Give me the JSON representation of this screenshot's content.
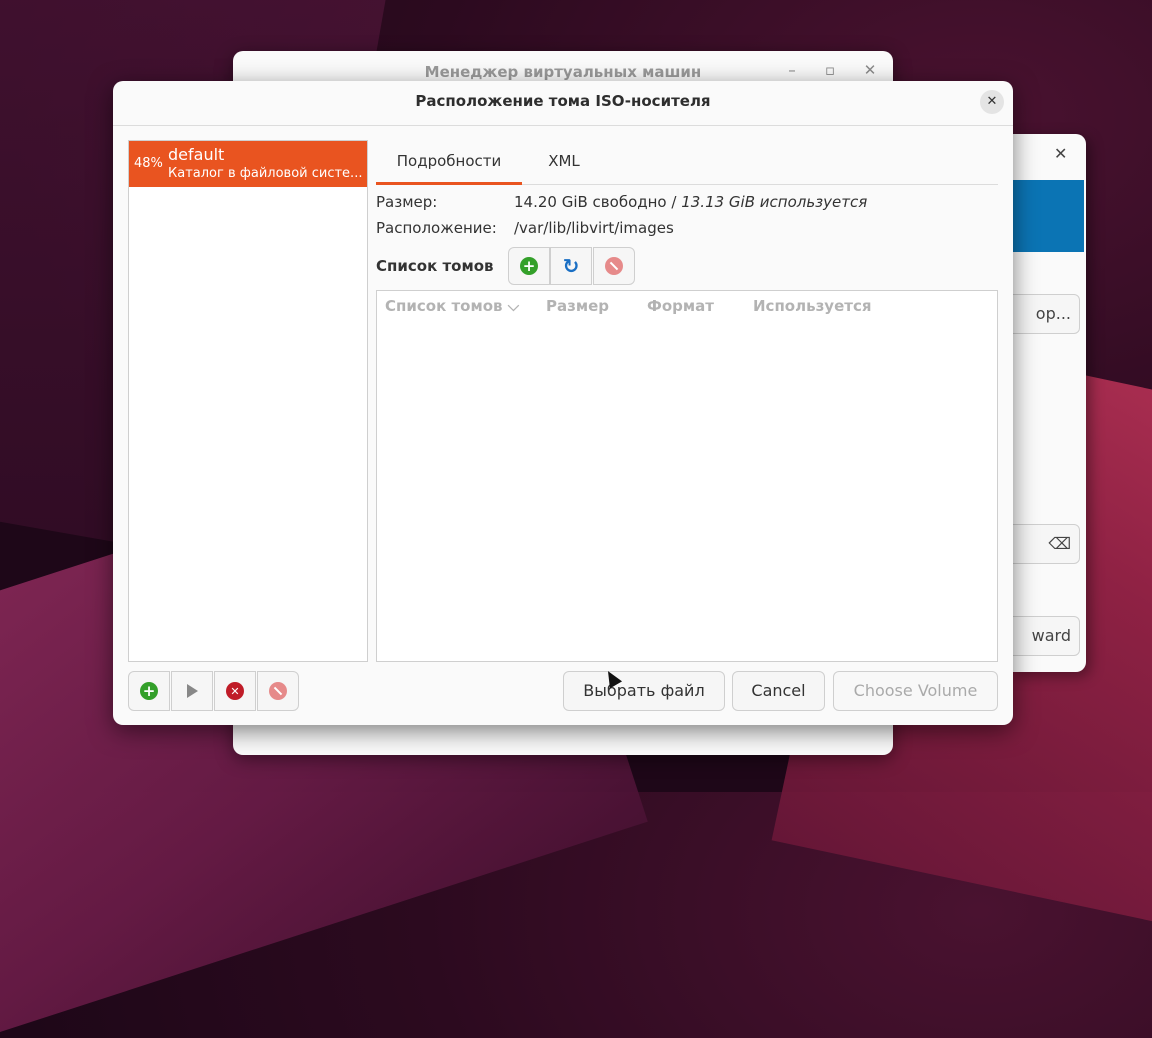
{
  "back_window": {
    "title": "Менеджер виртуальных машин",
    "controls": [
      "–",
      "▫",
      "✕"
    ]
  },
  "right_window": {
    "close": "✕",
    "button1": "ор...",
    "button2": "⌫",
    "button3": "ward"
  },
  "dialog": {
    "title": "Расположение тома ISO-носителя",
    "close": "✕",
    "pool": {
      "percent": "48%",
      "name": "default",
      "description": "Каталог в файловой систе..."
    },
    "tabs": [
      {
        "label": "Подробности",
        "active": true
      },
      {
        "label": "XML",
        "active": false
      }
    ],
    "details": {
      "size_label": "Размер:",
      "size_free": "14.20 GiB свободно /",
      "size_used": "13.13 GiB используется",
      "location_label": "Расположение:",
      "location_value": "/var/lib/libvirt/images",
      "volumes_label": "Список томов"
    },
    "table": {
      "columns": [
        "Список томов",
        "Размер",
        "Формат",
        "Используется"
      ],
      "sort_icon": "⌵"
    },
    "buttons": {
      "browse": "Выбрать файл",
      "cancel": "Cancel",
      "choose": "Choose Volume"
    }
  },
  "colors": {
    "accent": "#e95420",
    "add": "#34a02a",
    "delete": "#c01c28",
    "refresh": "#1a6fc4"
  }
}
